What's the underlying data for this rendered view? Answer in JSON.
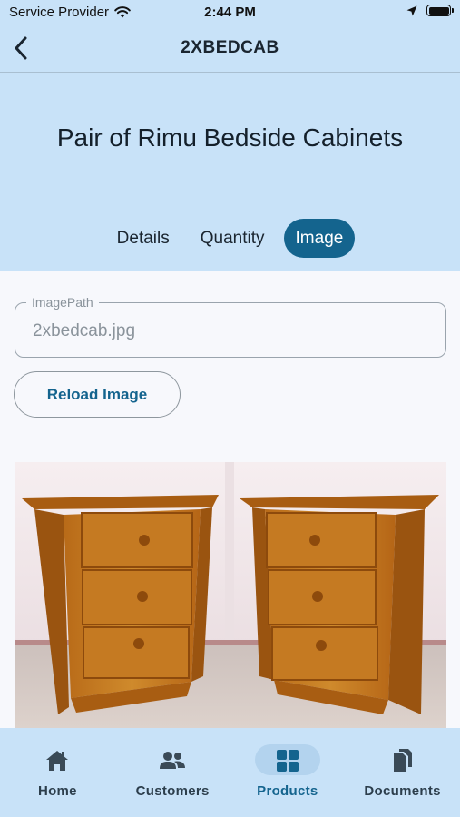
{
  "status_bar": {
    "carrier": "Service Provider",
    "time": "2:44 PM"
  },
  "header": {
    "title": "2XBEDCAB",
    "back_icon": "chevron-left-icon"
  },
  "product": {
    "title": "Pair of Rimu Bedside Cabinets"
  },
  "tabs": [
    {
      "label": "Details",
      "active": false
    },
    {
      "label": "Quantity",
      "active": false
    },
    {
      "label": "Image",
      "active": true
    }
  ],
  "image_form": {
    "field_label": "ImagePath",
    "field_value": "2xbedcab.jpg",
    "reload_label": "Reload Image"
  },
  "photo": {
    "subject": "bedside-cabinets-photo"
  },
  "bottom_nav": [
    {
      "label": "Home",
      "icon": "home-icon",
      "active": false
    },
    {
      "label": "Customers",
      "icon": "people-icon",
      "active": false
    },
    {
      "label": "Products",
      "icon": "grid-icon",
      "active": true
    },
    {
      "label": "Documents",
      "icon": "documents-icon",
      "active": false
    }
  ],
  "colors": {
    "header_bg": "#c8e2f8",
    "accent": "#14648e",
    "page_bg": "#f7f8fc"
  }
}
